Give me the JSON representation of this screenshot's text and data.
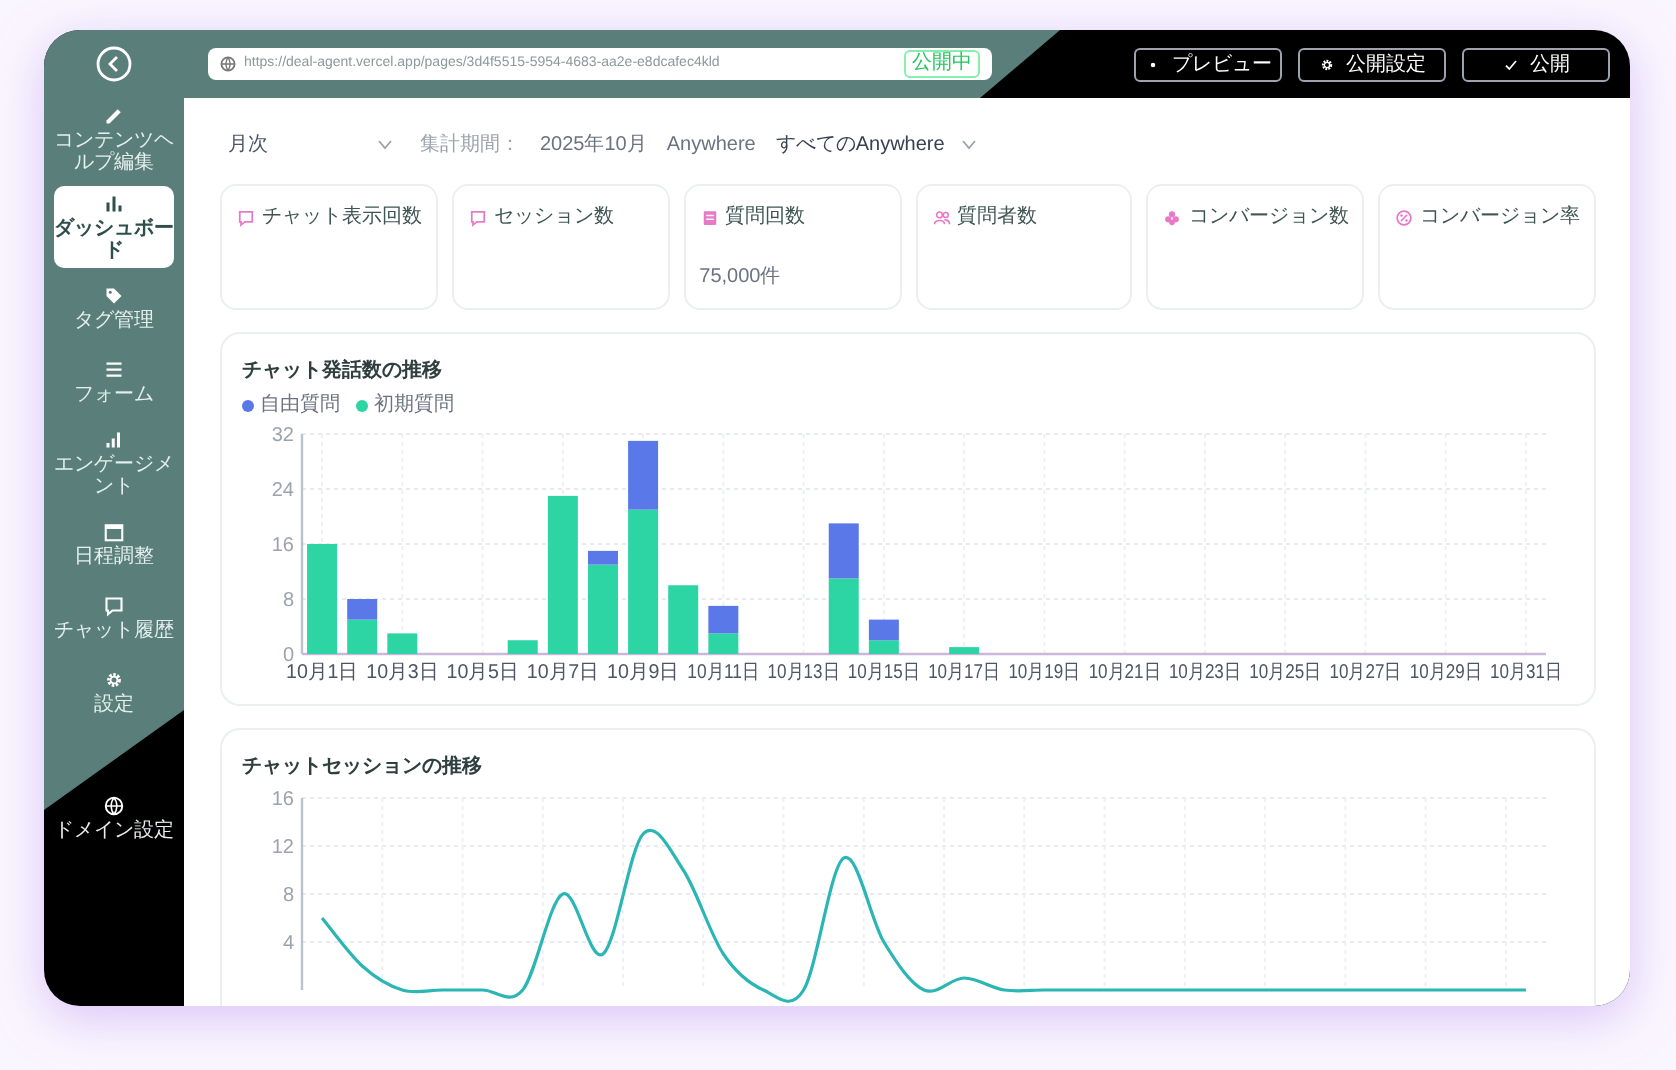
{
  "sidebar": {
    "items": [
      {
        "label": "コンテンツヘルプ編集",
        "selected": false
      },
      {
        "label": "ダッシュボード",
        "selected": true
      },
      {
        "label": "タグ管理",
        "selected": false
      },
      {
        "label": "フォーム",
        "selected": false
      },
      {
        "label": "エンゲージメント",
        "selected": false
      },
      {
        "label": "日程調整",
        "selected": false
      },
      {
        "label": "チャット履歴",
        "selected": false
      },
      {
        "label": "設定",
        "selected": false
      },
      {
        "label": "ドメイン設定",
        "selected": false
      }
    ]
  },
  "address_bar": {
    "url": "https://deal-agent.vercel.app/pages/3d4f5515-5954-4683-aa2e-e8dcafec4kld",
    "badge": "公開中"
  },
  "toolbar_buttons": [
    {
      "label": "プレビュー"
    },
    {
      "label": "公開設定"
    },
    {
      "label": "公開"
    }
  ],
  "filters": {
    "period_type": "月次",
    "period_label": "集計期間：",
    "period_value": "2025年10月",
    "channel_label": "Anywhere",
    "channel_value": "すべてのAnywhere"
  },
  "stat_cards": [
    {
      "title": "チャット表示回数"
    },
    {
      "title": "セッション数"
    },
    {
      "title": "質問回数",
      "value": "75,000件"
    },
    {
      "title": "質問者数"
    },
    {
      "title": "コンバージョン数"
    },
    {
      "title": "コンバージョン率"
    }
  ],
  "charts": [
    {
      "chart_data": {
        "type": "bar",
        "title": "チャット発話数の推移",
        "stacked": true,
        "grid": true,
        "categories": [
          "10月1日",
          null,
          "10月3日",
          null,
          "10月5日",
          null,
          "10月7日",
          null,
          "10月9日",
          null,
          "10月11日",
          null,
          "10月13日",
          null,
          "10月15日",
          null,
          "10月17日",
          null,
          "10月19日",
          null,
          "10月21日",
          null,
          "10月23日",
          null,
          "10月25日",
          null,
          "10月27日",
          null,
          "10月29日",
          null,
          "10月31日"
        ],
        "yticks": [
          0,
          8,
          16,
          24,
          32
        ],
        "ylim": [
          0,
          32
        ],
        "series": [
          {
            "name": "初期質問",
            "color": "#2dd4a4",
            "values": [
              16,
              5,
              3,
              0,
              0,
              2,
              23,
              13,
              21,
              10,
              3,
              0,
              0,
              11,
              2,
              0,
              1,
              0,
              0,
              0,
              0,
              0,
              0,
              0,
              0,
              0,
              0,
              0,
              0,
              0,
              0
            ]
          },
          {
            "name": "自由質問",
            "color": "#5b78e8",
            "values": [
              0,
              3,
              0,
              0,
              0,
              0,
              0,
              2,
              10,
              0,
              4,
              0,
              0,
              8,
              3,
              0,
              0,
              0,
              0,
              0,
              0,
              0,
              0,
              0,
              0,
              0,
              0,
              0,
              0,
              0,
              0
            ]
          }
        ]
      }
    },
    {
      "chart_data": {
        "type": "line",
        "title": "チャットセッションの推移",
        "grid": true,
        "yticks": [
          4,
          8,
          12,
          16
        ],
        "ylim": [
          0,
          16
        ],
        "series": [
          {
            "color": "#2bb5b5",
            "values": [
              6,
              2,
              0,
              0,
              0,
              0,
              8,
              3,
              13,
              10,
              3,
              0,
              0,
              11,
              4,
              0,
              1,
              0,
              0,
              0,
              0,
              0,
              0,
              0,
              0,
              0,
              0,
              0,
              0,
              0,
              0
            ]
          }
        ]
      }
    }
  ]
}
